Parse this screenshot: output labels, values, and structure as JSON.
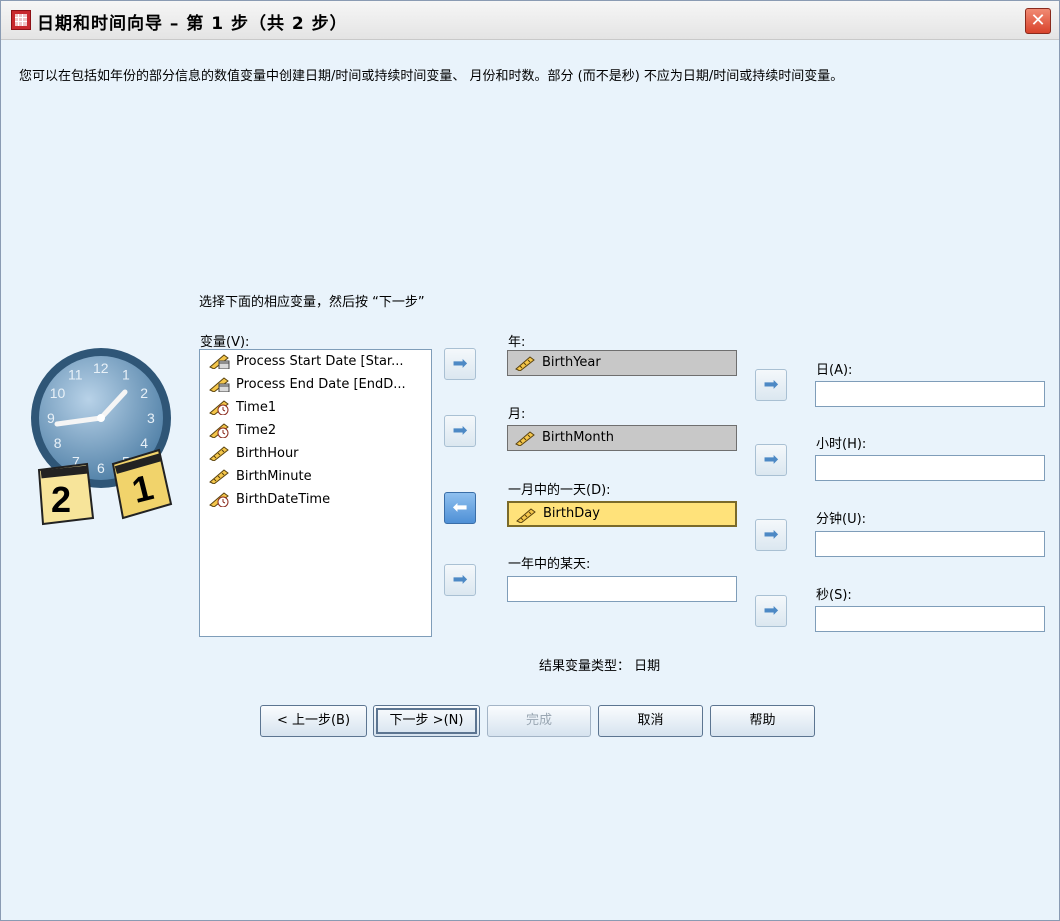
{
  "window": {
    "title": "日期和时间向导 – 第 1 步（共 2 步）",
    "close_glyph": "✕"
  },
  "description": "您可以在包括如年份的部分信息的数值变量中创建日期/时间或持续时间变量、 月份和时数。部分 (而不是秒) 不应为日期/时间或持续时间变量。",
  "instruction": "选择下面的相应变量，然后按 “下一步”",
  "variables": {
    "label": "变量(V):",
    "items": [
      {
        "name": "Process Start Date [Star...",
        "icon": "date-variable-icon"
      },
      {
        "name": "Process End Date [EndD...",
        "icon": "date-variable-icon"
      },
      {
        "name": "Time1",
        "icon": "time-variable-icon"
      },
      {
        "name": "Time2",
        "icon": "time-variable-icon"
      },
      {
        "name": "BirthHour",
        "icon": "scale-variable-icon"
      },
      {
        "name": "BirthMinute",
        "icon": "scale-variable-icon"
      },
      {
        "name": "BirthDateTime",
        "icon": "time-variable-icon"
      }
    ]
  },
  "fields": {
    "year": {
      "label": "年:",
      "value": "BirthYear"
    },
    "month": {
      "label": "月:",
      "value": "BirthMonth"
    },
    "day_of_month": {
      "label": "一月中的一天(D):",
      "value": "BirthDay"
    },
    "day_of_year": {
      "label": "一年中的某天:",
      "value": ""
    },
    "day": {
      "label": "日(A):",
      "value": ""
    },
    "hour": {
      "label": "小时(H):",
      "value": ""
    },
    "minute": {
      "label": "分钟(U):",
      "value": ""
    },
    "second": {
      "label": "秒(S):",
      "value": ""
    }
  },
  "arrow_glyph": "➡",
  "arrow_back_glyph": "⬅",
  "result_type": "结果变量类型： 日期",
  "buttons": {
    "back": "< 上一步(B)",
    "next": "下一步 >(N)",
    "finish": "完成",
    "cancel": "取消",
    "help": "帮助"
  },
  "clock_art": {
    "hours": [
      "12",
      "1",
      "2",
      "3",
      "4",
      "5",
      "6",
      "7",
      "8",
      "9",
      "10",
      "11"
    ],
    "card_left": "2",
    "card_right": "1"
  },
  "colors": {
    "dialog_bg": "#e9f3fb",
    "selected_field": "#ffe27a",
    "filled_field": "#c8c8c8",
    "accent": "#4d89c5"
  }
}
